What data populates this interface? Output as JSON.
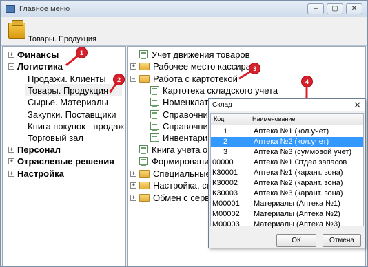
{
  "window": {
    "title": "Главное меню",
    "minimize": "–",
    "maximize": "▢",
    "close": "✕"
  },
  "header": {
    "title": "Товары. Продукция"
  },
  "left_tree": [
    {
      "label": "Финансы",
      "expander": "+",
      "bold": true
    },
    {
      "label": "Логистика",
      "expander": "–",
      "bold": true
    },
    {
      "label": "Продажи. Клиенты"
    },
    {
      "label": "Товары. Продукция",
      "selected": true
    },
    {
      "label": "Сырье. Материалы"
    },
    {
      "label": "Закупки. Поставщики"
    },
    {
      "label": "Книга покупок - продаж"
    },
    {
      "label": "Торговый зал"
    },
    {
      "label": "Персонал",
      "expander": "+",
      "bold": true
    },
    {
      "label": "Отраслевые решения",
      "expander": "+",
      "bold": true
    },
    {
      "label": "Настройка",
      "expander": "+",
      "bold": true
    }
  ],
  "right_tree": [
    {
      "label": "Учет движения товаров",
      "icon": "document"
    },
    {
      "label": "Рабочее место кассира",
      "icon": "folder",
      "expander": "+"
    },
    {
      "label": "Работа с картотекой",
      "icon": "folder",
      "expander": "–"
    },
    {
      "label": "Картотека складского учета",
      "icon": "document"
    },
    {
      "label": "Номенклатура",
      "icon": "document"
    },
    {
      "label": "Справочник",
      "icon": "document"
    },
    {
      "label": "Справочник",
      "icon": "document"
    },
    {
      "label": "Инвентаризация",
      "icon": "document"
    },
    {
      "label": "Книга учета оп",
      "icon": "document"
    },
    {
      "label": "Формирование",
      "icon": "document"
    },
    {
      "label": "Специальные",
      "icon": "folder",
      "expander": "+"
    },
    {
      "label": "Настройка, справ",
      "icon": "folder",
      "expander": "+"
    },
    {
      "label": "Обмен с серве",
      "icon": "folder",
      "expander": "+"
    }
  ],
  "badges": [
    "1",
    "2",
    "3",
    "4"
  ],
  "dialog": {
    "title": "Склад",
    "close": "✕",
    "columns": [
      "Код",
      "Наименование"
    ],
    "rows": [
      {
        "code": "1",
        "name": "Аптека №1 (кол.учет)"
      },
      {
        "code": "2",
        "name": "Аптека №2 (кол.учет)"
      },
      {
        "code": "3",
        "name": "Аптека №3 (суммовой учет)"
      },
      {
        "code": "00000",
        "name": "Аптека №1 Отдел запасов"
      },
      {
        "code": "К30001",
        "name": "Аптека №1 (карант. зона)"
      },
      {
        "code": "К30002",
        "name": "Аптека №2 (карант. зона)"
      },
      {
        "code": "К30003",
        "name": "Аптека №3 (карант. зона)"
      },
      {
        "code": "М00001",
        "name": "Материалы (Аптека №1)"
      },
      {
        "code": "М00002",
        "name": "Материалы (Аптека №2)"
      },
      {
        "code": "М00003",
        "name": "Материалы (Аптека №3)"
      }
    ],
    "selected_row": "2",
    "ok": "ОК",
    "cancel": "Отмена"
  },
  "colors": {
    "badge": "#d8202a",
    "selection": "#3399ff"
  }
}
